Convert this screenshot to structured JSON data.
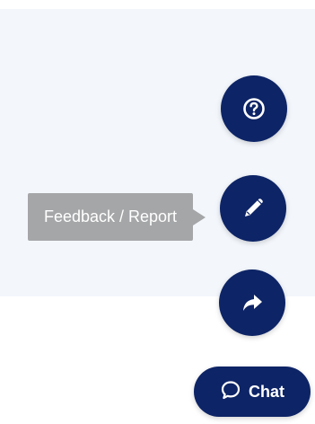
{
  "tooltip": {
    "text": "Feedback / Report"
  },
  "chat": {
    "label": "Chat"
  },
  "colors": {
    "button_bg": "#0d2466",
    "panel_bg": "#f3f7fc",
    "tooltip_bg": "#a5a6a8",
    "icon_fg": "#ffffff"
  },
  "icons": {
    "help": "question-circle-icon",
    "feedback": "pencil-icon",
    "share": "share-arrow-icon",
    "chat": "speech-bubble-icon"
  }
}
